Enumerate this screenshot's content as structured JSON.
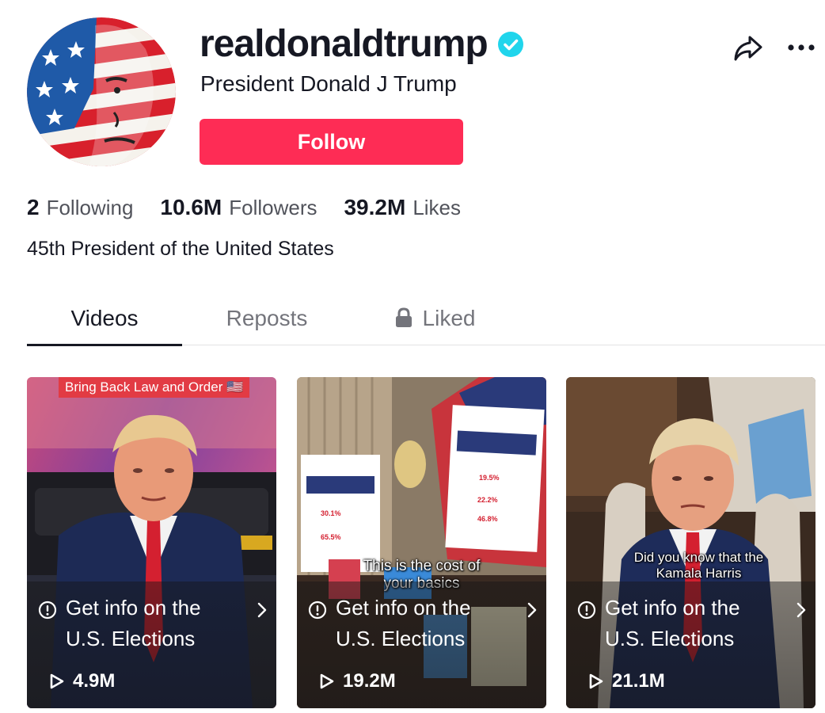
{
  "profile": {
    "username": "realdonaldtrump",
    "nickname": "President Donald J Trump",
    "follow_label": "Follow",
    "bio": "45th President of the United States",
    "verified": true
  },
  "stats": [
    {
      "value": "2",
      "label": "Following"
    },
    {
      "value": "10.6M",
      "label": "Followers"
    },
    {
      "value": "39.2M",
      "label": "Likes"
    }
  ],
  "tabs": [
    {
      "label": "Videos",
      "active": true
    },
    {
      "label": "Reposts",
      "active": false
    },
    {
      "label": "Liked",
      "active": false,
      "icon": "lock-icon"
    }
  ],
  "videos": [
    {
      "banner": "Bring Back Law and Order 🇺🇸",
      "caption": "",
      "info_line1": "Get info on the",
      "info_line2": "U.S. Elections",
      "views": "4.9M"
    },
    {
      "banner": "",
      "caption_line1": "This is the cost of",
      "caption_line2": "your basics",
      "info_line1": "Get info on the",
      "info_line2": "U.S. Elections",
      "views": "19.2M"
    },
    {
      "banner": "",
      "caption_line1": "Did you know that the",
      "caption_line2": "Kamala Harris",
      "info_line1": "Get info on the",
      "info_line2": "U.S. Elections",
      "views": "21.1M"
    }
  ],
  "colors": {
    "follow_bg": "#fe2c55",
    "verified": "#20d5ec",
    "text_primary": "#161823"
  },
  "icons": [
    "verified-badge-icon",
    "share-icon",
    "more-icon",
    "lock-icon",
    "info-icon",
    "chevron-right-icon",
    "play-icon"
  ]
}
